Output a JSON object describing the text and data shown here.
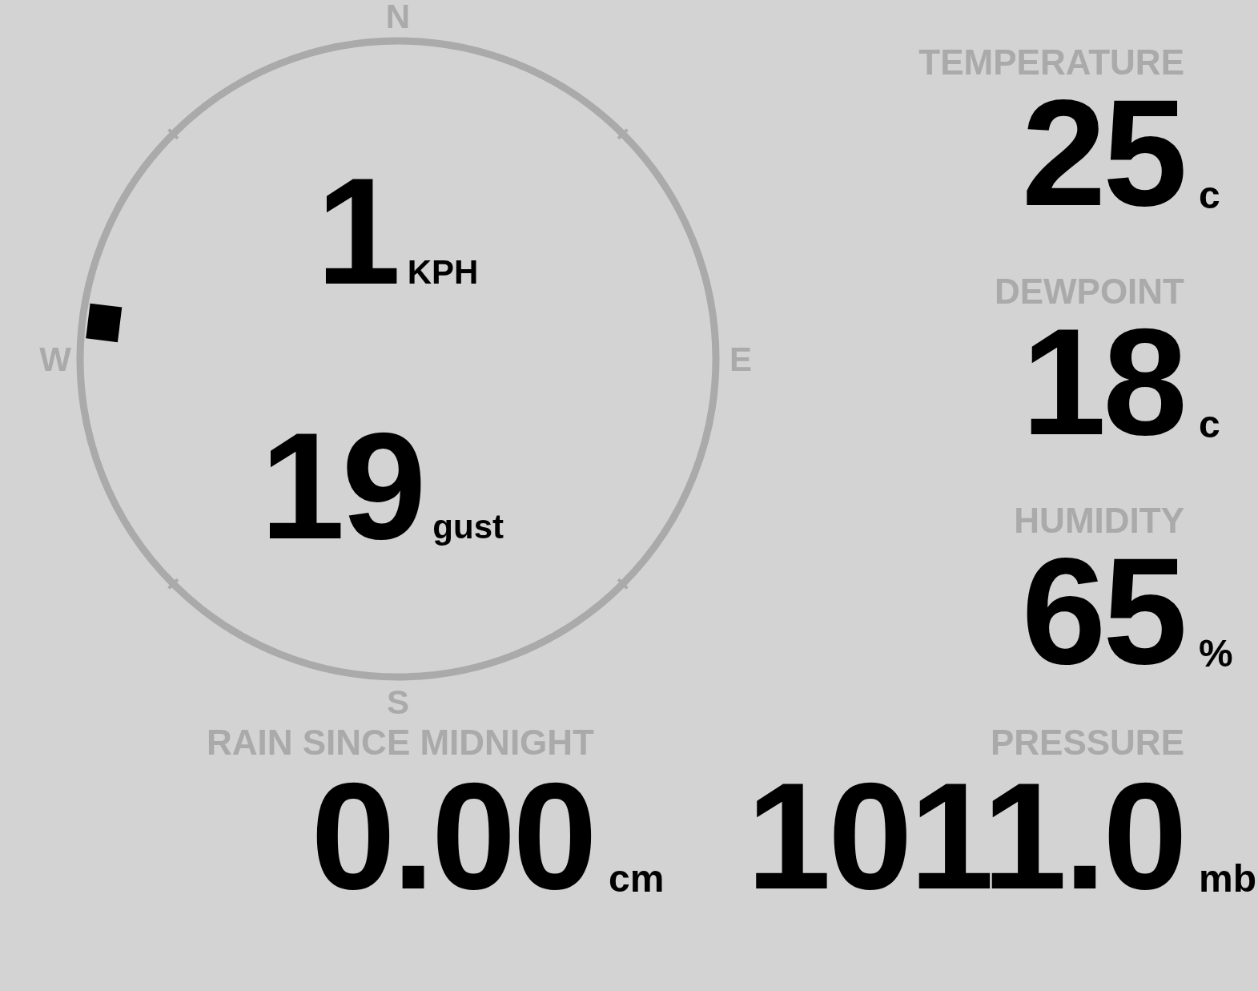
{
  "compass": {
    "labels": [
      "N",
      "E",
      "S",
      "W"
    ]
  },
  "wind": {
    "speed": "1",
    "speed_unit": "KPH",
    "gust": "19",
    "gust_label": "gust"
  },
  "readings": [
    {
      "label": "TEMPERATURE",
      "value": "25",
      "unit": "c"
    },
    {
      "label": "DEWPOINT",
      "value": "18",
      "unit": "c"
    },
    {
      "label": "HUMIDITY",
      "value": "65",
      "unit": "%"
    }
  ],
  "rain": {
    "label": "RAIN SINCE MIDNIGHT",
    "value": "0.00",
    "unit": "cm"
  },
  "pressure": {
    "label": "PRESSURE",
    "value": "1011.0",
    "unit": "mb"
  }
}
